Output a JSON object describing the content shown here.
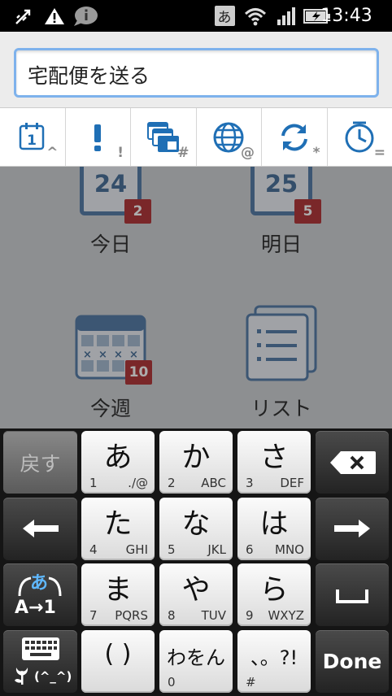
{
  "status_bar": {
    "clock": "13:43",
    "ime_indicator": "あ",
    "icons": [
      "usb-debug-icon",
      "warning-icon",
      "info-bubble-icon",
      "wifi-icon",
      "signal-icon",
      "battery-charging-icon"
    ]
  },
  "search": {
    "value": "宅配便を送る"
  },
  "toolbar": {
    "items": [
      {
        "icon": "calendar-icon",
        "symbol": "^"
      },
      {
        "icon": "exclamation-icon",
        "symbol": "!"
      },
      {
        "icon": "windows-icon",
        "symbol": "#"
      },
      {
        "icon": "globe-icon",
        "symbol": "@"
      },
      {
        "icon": "sync-icon",
        "symbol": "*"
      },
      {
        "icon": "clock-icon",
        "symbol": "="
      }
    ]
  },
  "main": {
    "tiles": [
      {
        "label": "今日",
        "date": "24",
        "count": "2"
      },
      {
        "label": "明日",
        "date": "25",
        "count": "5"
      },
      {
        "label": "今週",
        "count": "10"
      },
      {
        "label": "リスト"
      }
    ]
  },
  "keyboard": {
    "undo_label": "戻す",
    "done_label": "Done",
    "mode_switch": {
      "top": "あ",
      "bottom": "A→1"
    },
    "emoji_label": "(^_^)",
    "keys": [
      {
        "main": "あ",
        "num": "1",
        "sub": "./@"
      },
      {
        "main": "か",
        "num": "2",
        "sub": "ABC"
      },
      {
        "main": "さ",
        "num": "3",
        "sub": "DEF"
      },
      {
        "main": "た",
        "num": "4",
        "sub": "GHI"
      },
      {
        "main": "な",
        "num": "5",
        "sub": "JKL"
      },
      {
        "main": "は",
        "num": "6",
        "sub": "MNO"
      },
      {
        "main": "ま",
        "num": "7",
        "sub": "PQRS"
      },
      {
        "main": "や",
        "num": "8",
        "sub": "TUV"
      },
      {
        "main": "ら",
        "num": "9",
        "sub": "WXYZ"
      },
      {
        "main": "( )",
        "num": "",
        "sub": ""
      },
      {
        "main": "わをん",
        "num": "0",
        "sub": ""
      },
      {
        "main": "、。?!",
        "num": "#",
        "sub": ""
      }
    ]
  },
  "colors": {
    "accent": "#3d6a9b",
    "badge": "#a8191c",
    "focus_border": "#7eb2ec"
  }
}
